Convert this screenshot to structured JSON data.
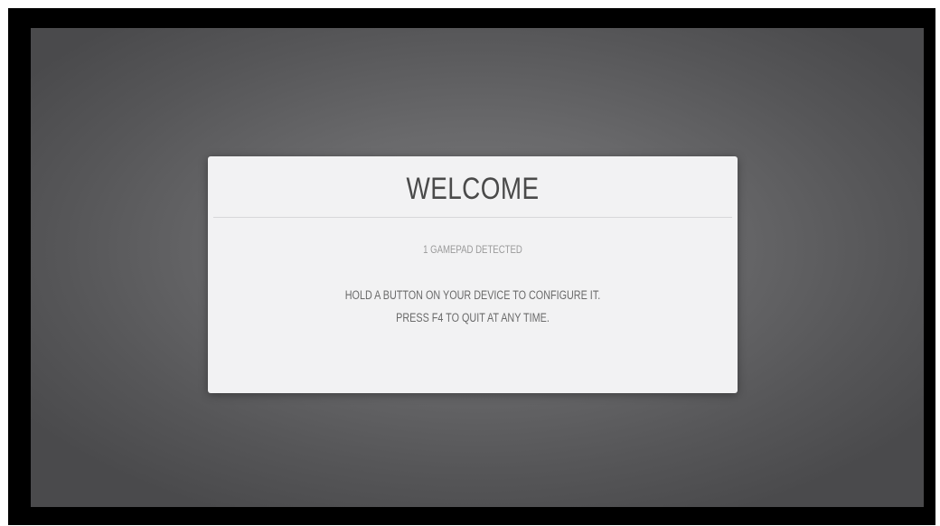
{
  "dialog": {
    "title": "WELCOME",
    "gamepad_status": "1 GAMEPAD DETECTED",
    "instruction_line1": "HOLD A BUTTON ON YOUR DEVICE TO CONFIGURE IT.",
    "instruction_line2": "PRESS F4 TO QUIT AT ANY TIME."
  }
}
